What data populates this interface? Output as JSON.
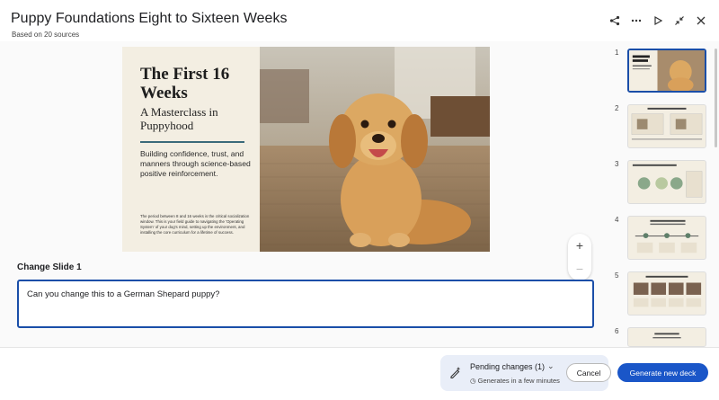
{
  "header": {
    "title": "Puppy Foundations Eight to Sixteen Weeks",
    "subtitle": "Based on 20 sources",
    "actions": [
      "share-icon",
      "more-icon",
      "play-icon",
      "collapse-icon",
      "close-icon"
    ]
  },
  "slide": {
    "heading": "The First 16 Weeks",
    "subheading": "A Masterclass in Puppyhood",
    "body": "Building confidence, trust, and manners through science-based positive reinforcement.",
    "small_text": "The period between 8 and 16 weeks is the critical socialization window. This is your field guide to navigating the 'Operating System' of your dog's mind, setting up the environment, and installing the core curriculum for a lifetime of success.",
    "accent_color": "#3b6a7a"
  },
  "zoom": {
    "plus": "+",
    "minus": "−"
  },
  "editor": {
    "label": "Change Slide 1",
    "prompt_value": "Can you change this to a German Shepard puppy?"
  },
  "thumbnails": [
    {
      "number": "1",
      "title": "The First 16 Weeks"
    },
    {
      "number": "2",
      "title": "The Science of Learning"
    },
    {
      "number": "3",
      "title": "The Operating System: Clicker Training"
    },
    {
      "number": "4",
      "title": "The Critical Window: A Developmental Roadmap"
    },
    {
      "number": "5",
      "title": "Routine is the Antidote to Anxiety"
    },
    {
      "number": "6",
      "title": "The Crate: A Sanctuary, Not a Cage"
    }
  ],
  "footer": {
    "pending_title": "Pending changes (1)",
    "pending_sub": "Generates in a few minutes",
    "cancel_label": "Cancel",
    "generate_label": "Generate new deck",
    "primary_color": "#1a56c8"
  }
}
